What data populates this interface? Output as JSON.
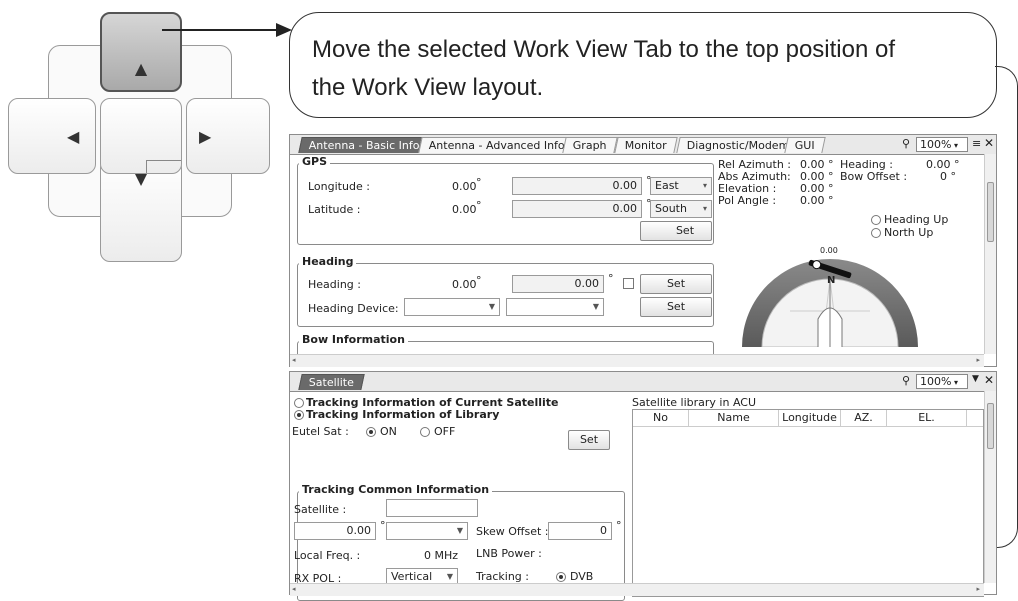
{
  "callout": {
    "line1": "Move the selected Work View Tab to the top position of",
    "line2": "the Work View layout."
  },
  "dpad": {
    "up": "▲",
    "left": "◀",
    "right": "▶",
    "down": "▼"
  },
  "top_panel": {
    "tabs": [
      "Antenna - Basic Info.",
      "Antenna - Advanced Info.",
      "Graph",
      "Monitor",
      "Diagnostic/Modem",
      "GUI"
    ],
    "zoom": "100%",
    "gps": {
      "title": "GPS",
      "longitude_label": "Longitude :",
      "longitude_value": "0.00",
      "longitude_input": "0.00",
      "longitude_dir": "East",
      "latitude_label": "Latitude :",
      "latitude_value": "0.00",
      "latitude_input": "0.00",
      "latitude_dir": "South",
      "set": "Set",
      "deg": "°"
    },
    "heading": {
      "title": "Heading",
      "heading_label": "Heading :",
      "heading_value": "0.00",
      "heading_input": "0.00",
      "device_label": "Heading Device:",
      "set": "Set",
      "set2": "Set"
    },
    "bow": {
      "title": "Bow Information"
    },
    "status": {
      "rel_az": "Rel Azimuth :",
      "rel_az_v": "0.00 °",
      "abs_az": "Abs Azimuth:",
      "abs_az_v": "0.00 °",
      "elev": "Elevation   :",
      "elev_v": "0.00 °",
      "pol": "Pol Angle   :",
      "pol_v": "0.00 °",
      "heading": "Heading   :",
      "heading_v": "0.00 °",
      "bow_offset": "Bow Offset :",
      "bow_offset_v": "0 °",
      "heading_up": "Heading Up",
      "north_up": "North Up",
      "compass_val": "0.00",
      "compass_n": "N"
    }
  },
  "bottom_panel": {
    "tab": "Satellite",
    "zoom": "100%",
    "radio_current": "Tracking Information of Current Satellite",
    "radio_library": "Tracking Information of Library",
    "eutel": "Eutel Sat :",
    "on": "ON",
    "off": "OFF",
    "set": "Set",
    "library_title": "Satellite library in ACU",
    "columns": [
      "No",
      "Name",
      "Longitude",
      "AZ.",
      "EL."
    ],
    "common": {
      "title": "Tracking Common  Information",
      "satellite": "Satellite :",
      "val": "0.00",
      "deg": "°",
      "skew": "Skew Offset :",
      "skew_v": "0",
      "local_freq": "Local Freq. :",
      "local_freq_v": "0 MHz",
      "lnb": "LNB Power :",
      "rx_pol": "RX POL :",
      "rx_pol_v": "Vertical",
      "tracking": "Tracking :",
      "dvb": "DVB"
    }
  }
}
